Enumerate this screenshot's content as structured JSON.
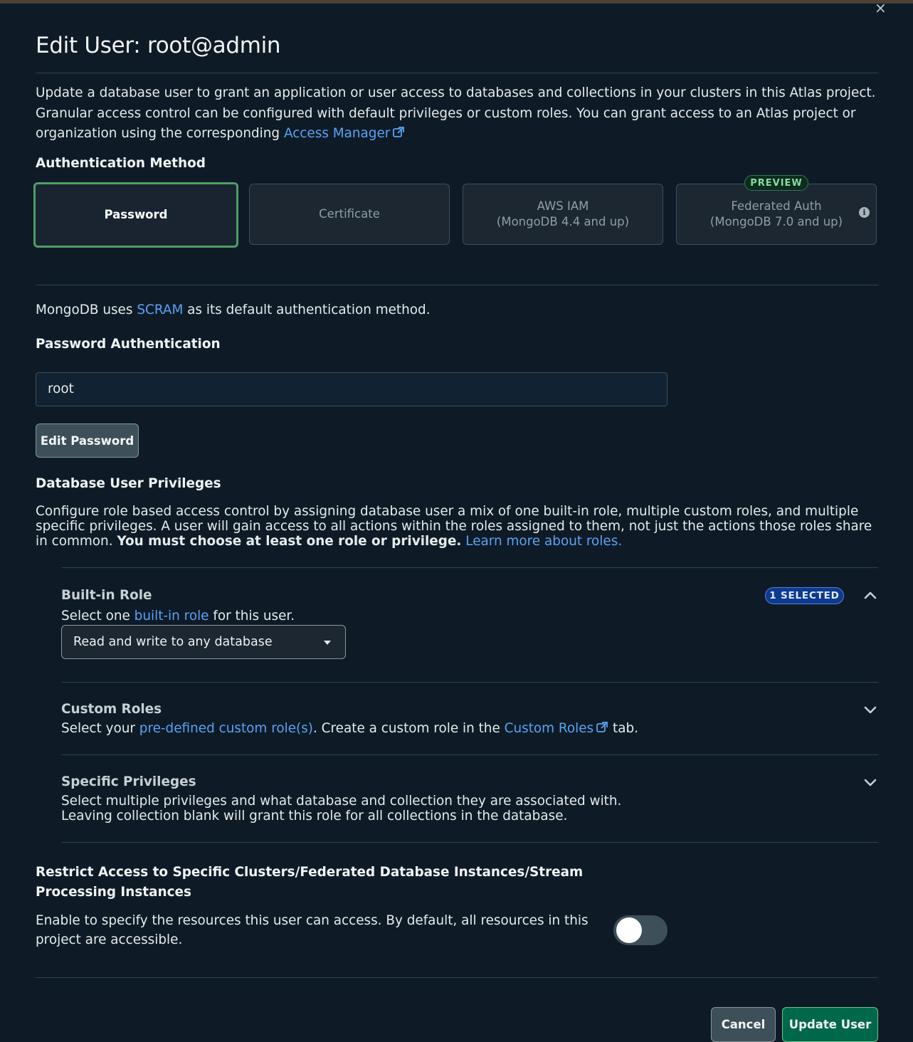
{
  "modal": {
    "title": "Edit User: root@admin",
    "close_label": "×",
    "intro_text": "Update a database user to grant an application or user access to databases and collections in your clusters in this Atlas project. Granular access control can be configured with default privileges or custom roles. You can grant access to an Atlas project or organization using the corresponding ",
    "intro_link": "Access Manager"
  },
  "auth": {
    "heading": "Authentication Method",
    "methods": [
      {
        "label": "Password",
        "selected": true
      },
      {
        "label": "Certificate",
        "selected": false
      },
      {
        "label": "AWS IAM",
        "sub": "(MongoDB 4.4 and up)",
        "selected": false
      },
      {
        "label": "Federated Auth",
        "sub": "(MongoDB 7.0 and up)",
        "badge": "PREVIEW",
        "selected": false
      }
    ],
    "info_icon": "i"
  },
  "scram": {
    "prefix": "MongoDB uses ",
    "link": "SCRAM",
    "suffix": " as its default authentication method."
  },
  "password_auth": {
    "heading": "Password Authentication",
    "username_value": "root",
    "edit_password_label": "Edit Password"
  },
  "privileges": {
    "heading": "Database User Privileges",
    "desc_1": "Configure role based access control by assigning database user a mix of one built-in role, multiple custom roles, and multiple specific privileges. A user will gain access to all actions within the roles assigned to them, not just the actions those roles share in common. ",
    "desc_bold": "You must choose at least one role or privilege.",
    "desc_link": "Learn more about roles."
  },
  "builtin_role": {
    "title": "Built-in Role",
    "badge": "1 SELECTED",
    "sub_prefix": "Select one ",
    "sub_link": "built-in role",
    "sub_suffix": " for this user.",
    "selected_value": "Read and write to any database"
  },
  "custom_roles": {
    "title": "Custom Roles",
    "sub_prefix": "Select your ",
    "sub_link": "pre-defined custom role(s)",
    "sub_middle": ". Create a custom role in the ",
    "sub_link2": "Custom Roles",
    "sub_suffix": " tab."
  },
  "specific_privileges": {
    "title": "Specific Privileges",
    "line1": "Select multiple privileges and what database and collection they are associated with.",
    "line2": "Leaving collection blank will grant this role for all collections in the database."
  },
  "restrict": {
    "title": "Restrict Access to Specific Clusters/Federated Database Instances/Stream Processing Instances",
    "text": "Enable to specify the resources this user can access. By default, all resources in this project are accessible.",
    "toggle_on": false
  },
  "footer": {
    "cancel_label": "Cancel",
    "update_label": "Update User"
  },
  "colors": {
    "background": "#0e1b27",
    "link": "#5aa2f2",
    "selected_border": "#4f9d65",
    "primary_button": "#00684a",
    "badge_blue": "#0d3a8e"
  }
}
